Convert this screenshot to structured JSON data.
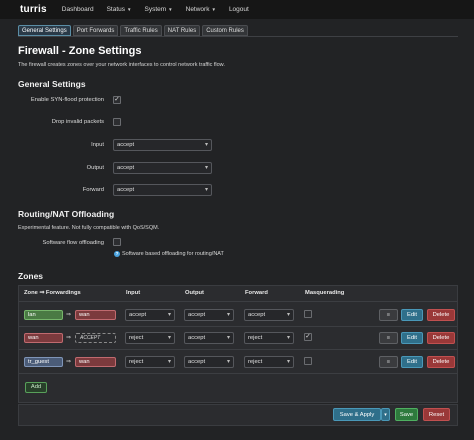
{
  "navbar": {
    "brand": "turris",
    "items": [
      {
        "label": "Dashboard",
        "has_caret": false
      },
      {
        "label": "Status",
        "has_caret": true
      },
      {
        "label": "System",
        "has_caret": true
      },
      {
        "label": "Network",
        "has_caret": true
      },
      {
        "label": "Logout",
        "has_caret": false
      }
    ]
  },
  "tabs": [
    "General Settings",
    "Port Forwards",
    "Traffic Rules",
    "NAT Rules",
    "Custom Rules"
  ],
  "active_tab": "General Settings",
  "page": {
    "title": "Firewall - Zone Settings",
    "description": "The firewall creates zones over your network interfaces to control network traffic flow."
  },
  "general": {
    "heading": "General Settings",
    "syn_flood_label": "Enable SYN-flood protection",
    "syn_flood_checked": true,
    "drop_invalid_label": "Drop invalid packets",
    "drop_invalid_checked": false,
    "input_label": "Input",
    "input_value": "accept",
    "output_label": "Output",
    "output_value": "accept",
    "forward_label": "Forward",
    "forward_value": "accept"
  },
  "offload": {
    "heading": "Routing/NAT Offloading",
    "description": "Experimental feature. Not fully compatible with QoS/SQM.",
    "sw_label": "Software flow offloading",
    "sw_checked": false,
    "hint": "Software based offloading for routing/NAT"
  },
  "zones": {
    "heading": "Zones",
    "columns": {
      "zone": "Zone ⇒ Forwardings",
      "input": "Input",
      "output": "Output",
      "forward": "Forward",
      "masq": "Masquerading"
    },
    "rows": [
      {
        "zone": "lan",
        "forward_to": "wan",
        "input": "accept",
        "output": "accept",
        "forward": "accept",
        "masquerading": false
      },
      {
        "zone": "wan",
        "forward_to": "ACCEPT",
        "input": "reject",
        "output": "accept",
        "forward": "reject",
        "masquerading": true
      },
      {
        "zone": "tr_guest",
        "forward_to": "wan",
        "input": "reject",
        "output": "accept",
        "forward": "reject",
        "masquerading": false
      }
    ],
    "menu_icon": "≡",
    "edit_label": "Edit",
    "delete_label": "Delete",
    "add_label": "Add"
  },
  "footer": {
    "save_apply": "Save & Apply",
    "save": "Save",
    "reset": "Reset"
  },
  "colors": {
    "accent": "#2f6f8a",
    "danger": "#9a3838",
    "success": "#2e7a3d",
    "lan": "#4a7a44",
    "wan": "#7c3a3d",
    "guest": "#4b5c78"
  }
}
